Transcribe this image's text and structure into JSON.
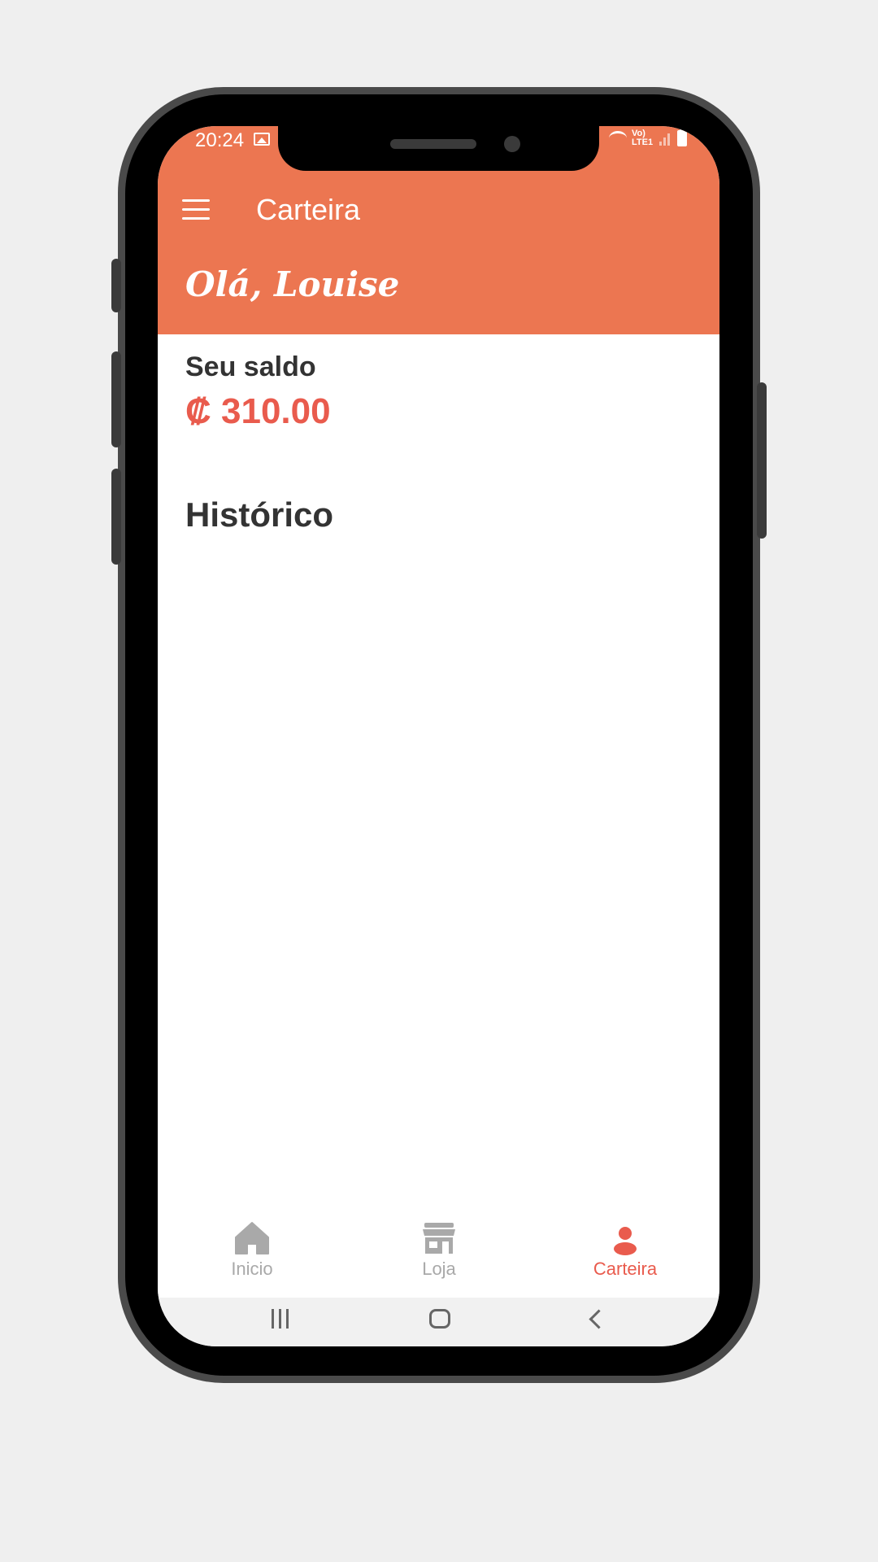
{
  "status_bar": {
    "time": "20:24",
    "network_label": "Vo) LTE1"
  },
  "app_bar": {
    "title": "Carteira"
  },
  "header": {
    "greeting": "Olá, Louise"
  },
  "balance": {
    "label": "Seu saldo",
    "value": "₡ 310.00"
  },
  "history": {
    "title": "Histórico"
  },
  "bottom_nav": {
    "items": [
      {
        "label": "Inicio",
        "icon": "home-icon",
        "active": false
      },
      {
        "label": "Loja",
        "icon": "store-icon",
        "active": false
      },
      {
        "label": "Carteira",
        "icon": "person-icon",
        "active": true
      }
    ]
  },
  "colors": {
    "primary": "#ec7651",
    "accent": "#e95b4d",
    "text_dark": "#333333",
    "inactive": "#a9a9a9"
  }
}
